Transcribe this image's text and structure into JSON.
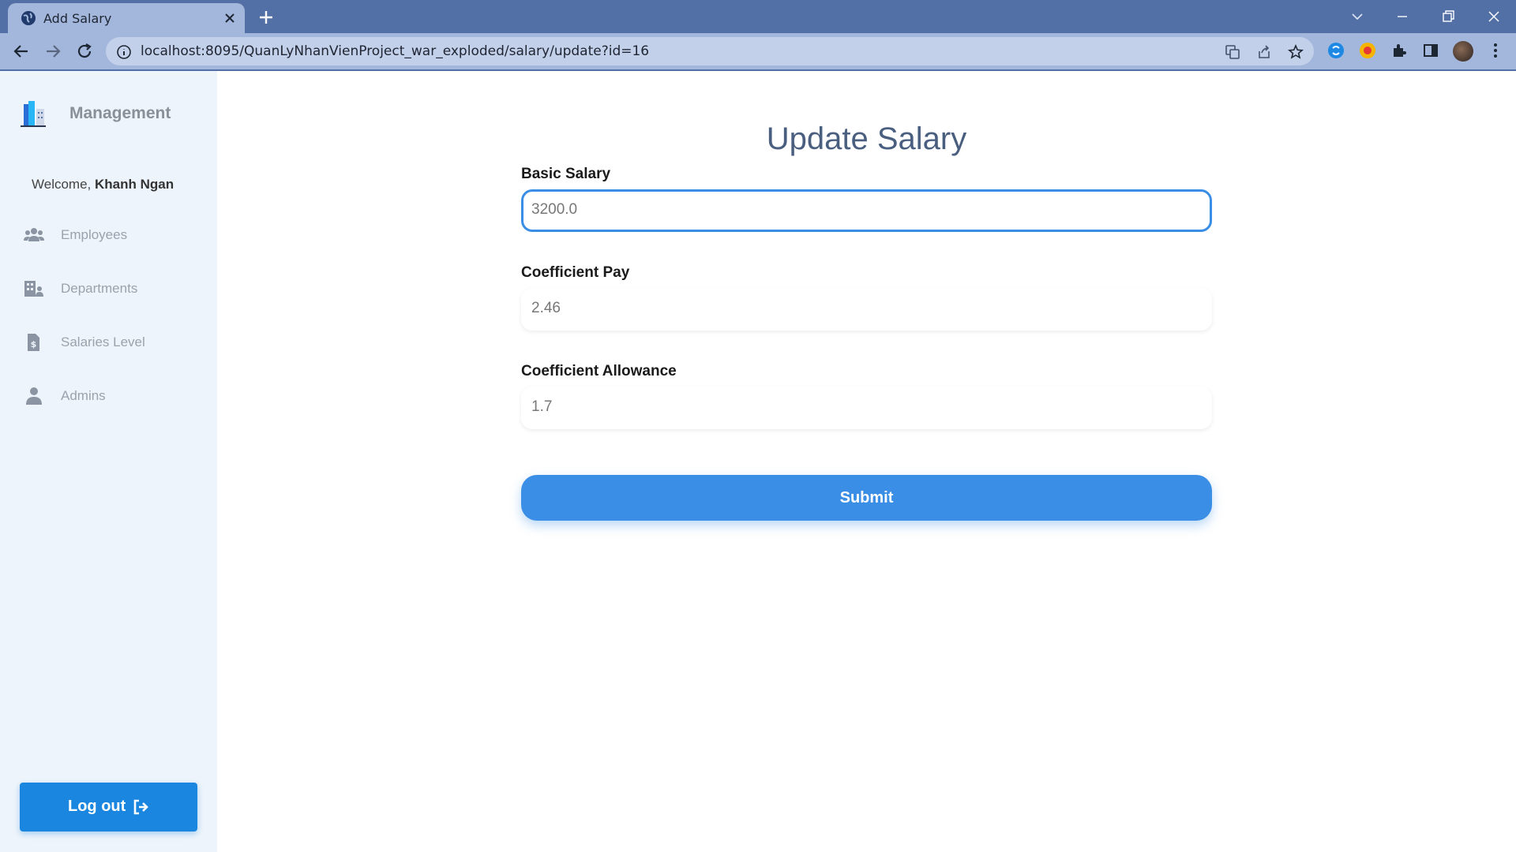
{
  "browser": {
    "tab_title": "Add Salary",
    "url": "localhost:8095/QuanLyNhanVienProject_war_exploded/salary/update?id=16"
  },
  "sidebar": {
    "brand": "Management",
    "welcome_prefix": "Welcome,",
    "user_name": "Khanh Ngan",
    "items": [
      {
        "label": "Employees",
        "icon": "users-icon"
      },
      {
        "label": "Departments",
        "icon": "building-icon"
      },
      {
        "label": "Salaries Level",
        "icon": "invoice-dollar-icon"
      },
      {
        "label": "Admins",
        "icon": "user-icon"
      }
    ],
    "logout_label": "Log out"
  },
  "form": {
    "title": "Update Salary",
    "basic_salary_label": "Basic Salary",
    "basic_salary_value": "3200.0",
    "coefficient_pay_label": "Coefficient Pay",
    "coefficient_pay_value": "2.46",
    "coefficient_allowance_label": "Coefficient Allowance",
    "coefficient_allowance_value": "1.7",
    "submit_label": "Submit"
  },
  "colors": {
    "accent": "#3a8ee6",
    "sidebar_bg": "#eef4fb",
    "chrome": "#5370a6"
  }
}
